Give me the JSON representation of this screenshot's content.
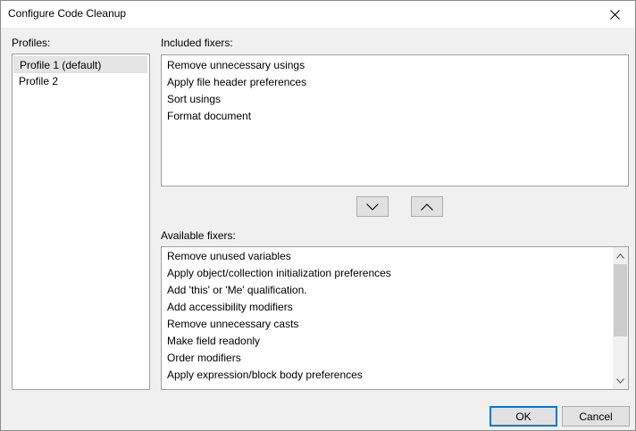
{
  "window": {
    "title": "Configure Code Cleanup"
  },
  "profiles": {
    "label": "Profiles:",
    "items": [
      "Profile 1 (default)",
      "Profile 2"
    ],
    "selected": "Profile 1 (default)"
  },
  "included": {
    "label": "Included fixers:",
    "items": [
      "Remove unnecessary usings",
      "Apply file header preferences",
      "Sort usings",
      "Format document"
    ]
  },
  "available": {
    "label": "Available fixers:",
    "items": [
      "Remove unused variables",
      "Apply object/collection initialization preferences",
      "Add 'this' or 'Me' qualification.",
      "Add accessibility modifiers",
      "Remove unnecessary casts",
      "Make field readonly",
      "Order modifiers",
      "Apply expression/block body preferences"
    ]
  },
  "buttons": {
    "ok": "OK",
    "cancel": "Cancel"
  },
  "icons": {
    "close": "close-icon",
    "move_down": "chevron-down-icon",
    "move_up": "chevron-up-icon"
  },
  "colors": {
    "selection": "#e5e5e5",
    "default_button_border": "#0078d7"
  }
}
